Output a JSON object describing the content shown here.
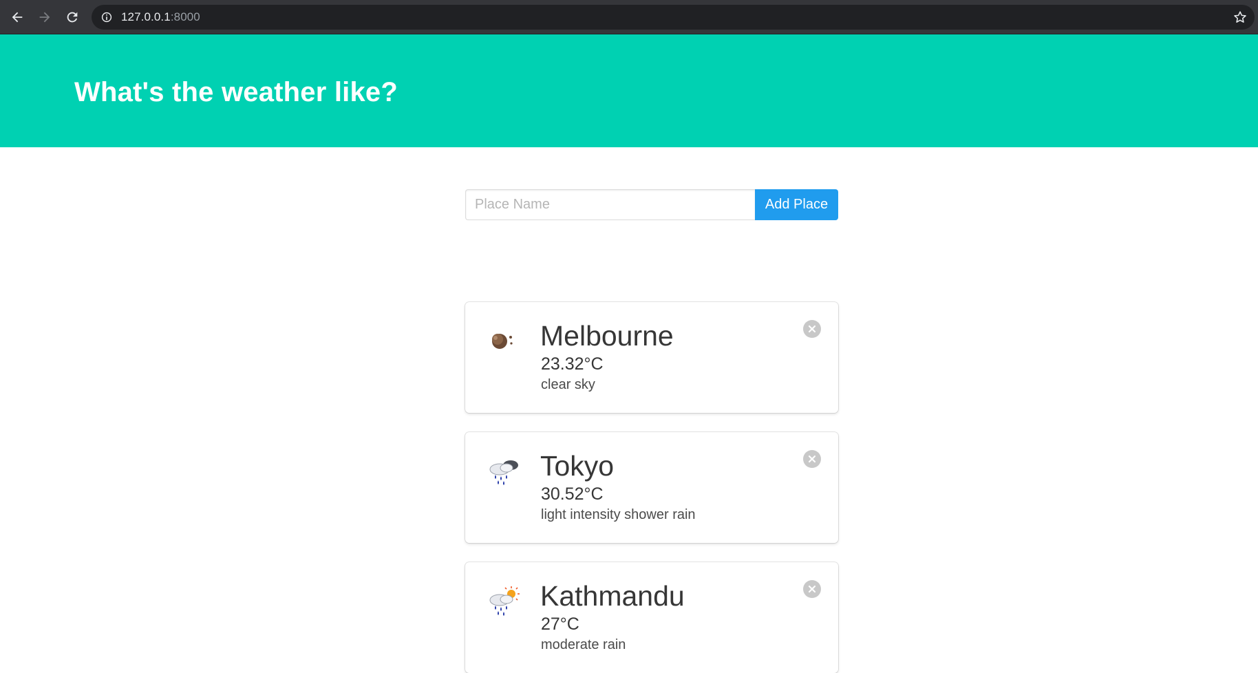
{
  "browser": {
    "url_host": "127.0.0.1",
    "url_port": ":8000"
  },
  "hero": {
    "title": "What's the weather like?"
  },
  "form": {
    "placeholder": "Place Name",
    "button_label": "Add Place"
  },
  "cards": [
    {
      "city": "Melbourne",
      "temperature": "23.32°C",
      "description": "clear sky",
      "icon": "clear-night-icon"
    },
    {
      "city": "Tokyo",
      "temperature": "30.52°C",
      "description": "light intensity shower rain",
      "icon": "shower-rain-icon"
    },
    {
      "city": "Kathmandu",
      "temperature": "27°C",
      "description": "moderate rain",
      "icon": "rain-sun-icon"
    }
  ],
  "colors": {
    "hero_bg": "#00d1b2",
    "button_bg": "#209cee"
  }
}
